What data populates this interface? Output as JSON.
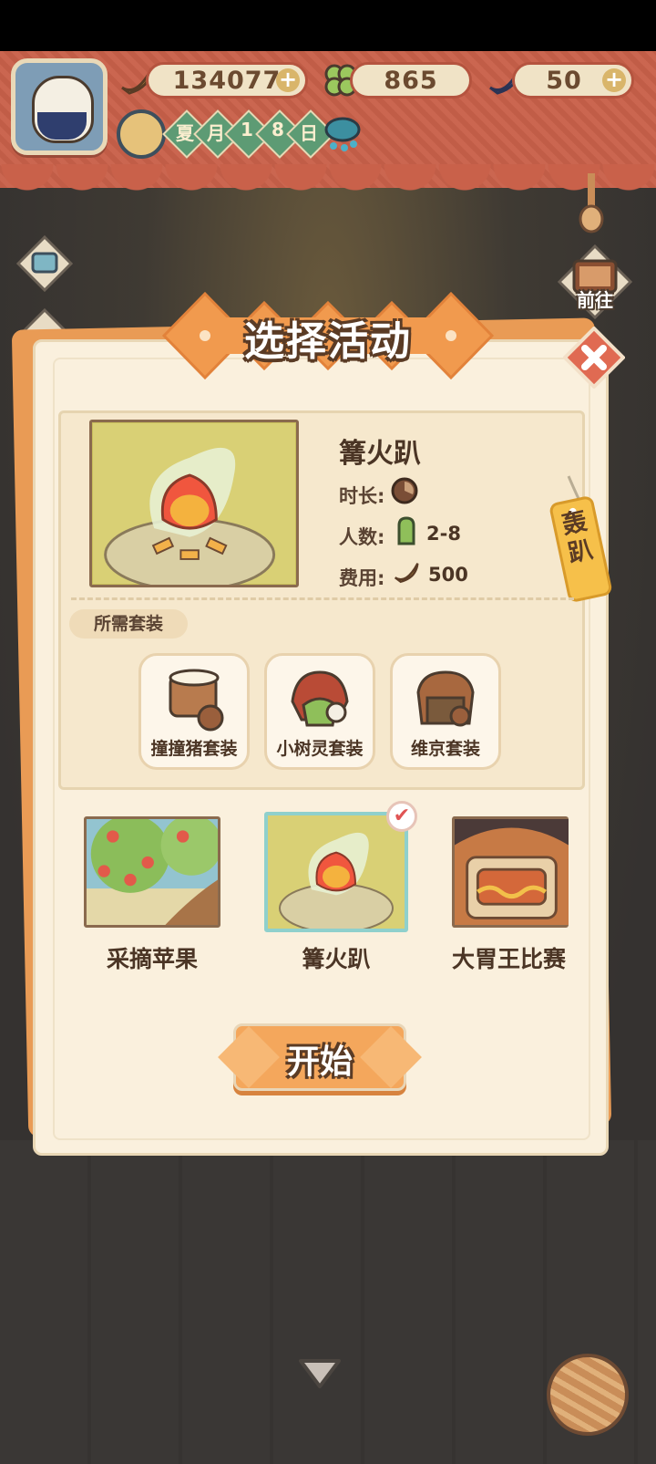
{
  "hud": {
    "currencies": [
      {
        "icon": "banana-icon",
        "value": "134077"
      },
      {
        "icon": "clover-icon",
        "value": "865"
      },
      {
        "icon": "blue-banana-icon",
        "value": "50"
      }
    ],
    "date_chars": [
      "夏",
      "月",
      "1",
      "8",
      "日"
    ],
    "plus": "+"
  },
  "side": {
    "go_label": "前往"
  },
  "dialog": {
    "title": "选择活动",
    "selected": {
      "name": "篝火趴",
      "duration_label": "时长:",
      "people_label": "人数:",
      "people_value": "2-8",
      "cost_label": "费用:",
      "cost_value": "500",
      "tag_text": "轰趴"
    },
    "required_suits_label": "所需套装",
    "suits": [
      {
        "label": "撞撞猪套装"
      },
      {
        "label": "小树灵套装"
      },
      {
        "label": "维京套装"
      }
    ],
    "activities": [
      {
        "label": "采摘苹果",
        "selected": false
      },
      {
        "label": "篝火趴",
        "selected": true
      },
      {
        "label": "大胃王比赛",
        "selected": false
      }
    ],
    "check_mark": "✔",
    "start_label": "开始"
  },
  "colors": {
    "accent": "#f4a75c",
    "panel": "#faf0dd",
    "curtain": "#c9614a",
    "text_dark": "#4b3525"
  }
}
